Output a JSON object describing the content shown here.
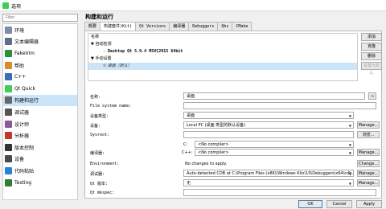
{
  "window": {
    "title": "选项"
  },
  "filter": {
    "placeholder": "Filter"
  },
  "nav": [
    {
      "label": "环境",
      "icon": "environment-icon",
      "color": "#7a8da8"
    },
    {
      "label": "文本编辑器",
      "icon": "text-editor-icon",
      "color": "#5a6f8c"
    },
    {
      "label": "FakeVim",
      "icon": "fakevim-icon",
      "color": "#2c8f3c"
    },
    {
      "label": "帮助",
      "icon": "help-icon",
      "color": "#d98c2b"
    },
    {
      "label": "C++",
      "icon": "cpp-icon",
      "color": "#3b6db3"
    },
    {
      "label": "Qt Quick",
      "icon": "qt-quick-icon",
      "color": "#41cd52"
    },
    {
      "label": "构建和运行",
      "icon": "build-run-icon",
      "color": "#666666"
    },
    {
      "label": "调试器",
      "icon": "debugger-icon",
      "color": "#555555"
    },
    {
      "label": "设计师",
      "icon": "designer-icon",
      "color": "#8a5a9c"
    },
    {
      "label": "分析器",
      "icon": "analyzer-icon",
      "color": "#c0392b"
    },
    {
      "label": "版本控制",
      "icon": "version-control-icon",
      "color": "#333333"
    },
    {
      "label": "设备",
      "icon": "devices-icon",
      "color": "#4a4a4a"
    },
    {
      "label": "代码粘贴",
      "icon": "code-paste-icon",
      "color": "#2b7fd9"
    },
    {
      "label": "Testing",
      "icon": "testing-icon",
      "color": "#2e7d32"
    }
  ],
  "heading": "构建和运行",
  "tabs": [
    "概要",
    "构建套件(Kit)",
    "Qt Versions",
    "编译器",
    "Debuggers",
    "Qbs",
    "CMake"
  ],
  "tree": {
    "header": "名称",
    "auto": "自动检测",
    "auto_kit": "Desktop Qt 5.9.4 MSVC2015 64bit",
    "manual": "手动设置",
    "manual_kit": "桌面（默认）"
  },
  "side_buttons": {
    "add": "添加",
    "clone": "克隆",
    "remove": "删除",
    "default": "设置为默认"
  },
  "form": {
    "name_label": "名称:",
    "name_value": "桌面",
    "fs_label": "File system name:",
    "device_type_label": "设备类型:",
    "device_type_value": "桌面",
    "device_label": "设备:",
    "device_value": "Local PC (桌面 类型的默认设备)",
    "sysroot_label": "Sysroot:",
    "browse": "浏览...",
    "compiler_label": "编译器:",
    "c_label": "C:",
    "c_value": "<No compiler>",
    "cpp_label": "C++:",
    "cpp_value": "<No compiler>",
    "env_label": "Environment:",
    "env_value": "No changes to apply.",
    "change": "Change...",
    "debugger_label": "调试器:",
    "debugger_value": "Auto-detected CDB at C:\\Program Files (x86)\\Windows Kits\\10\\Debuggers\\x64\\cdb.exe",
    "qt_label": "Qt 版本:",
    "qt_value": "无",
    "mkspec_label": "Qt mkspec:",
    "manage": "Manage..."
  },
  "footer": {
    "ok": "OK",
    "cancel": "Cancel",
    "apply": "Apply"
  }
}
